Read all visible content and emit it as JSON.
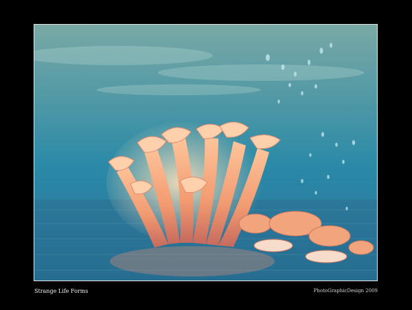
{
  "caption": {
    "title": "Strange Life Forms",
    "credit": "PhotoGraphicDesign 2009"
  },
  "colors": {
    "background": "#000000",
    "frame_border": "#e8e8e8",
    "water_top": "#6fa6a6",
    "water_bottom": "#1f6f9a",
    "coral": "#f4a37a"
  }
}
